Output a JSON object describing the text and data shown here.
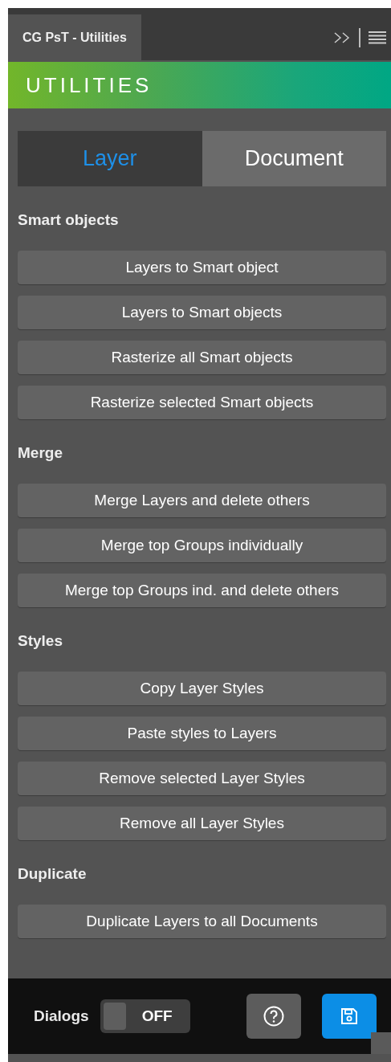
{
  "panel_tab": {
    "title": "CG PsT - Utilities"
  },
  "banner": {
    "title": "UTILITIES"
  },
  "tabs": [
    {
      "label": "Layer",
      "selected": true
    },
    {
      "label": "Document",
      "selected": false
    }
  ],
  "sections": [
    {
      "heading": "Smart objects",
      "buttons": [
        "Layers to Smart object",
        "Layers to Smart objects",
        "Rasterize all Smart objects",
        "Rasterize selected Smart objects"
      ]
    },
    {
      "heading": "Merge",
      "buttons": [
        "Merge Layers and delete others",
        "Merge top Groups individually",
        "Merge top Groups ind. and delete others"
      ]
    },
    {
      "heading": "Styles",
      "buttons": [
        "Copy Layer Styles",
        "Paste styles to Layers",
        "Remove selected Layer Styles",
        "Remove all Layer Styles"
      ]
    },
    {
      "heading": "Duplicate",
      "buttons": [
        "Duplicate Layers to all Documents"
      ]
    }
  ],
  "footer": {
    "dialogs_label": "Dialogs",
    "dialogs_toggle": {
      "on": false,
      "text": "OFF"
    }
  }
}
